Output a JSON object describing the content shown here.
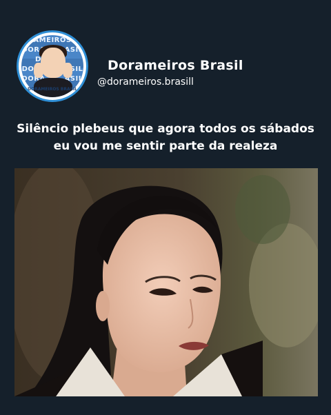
{
  "profile": {
    "name": "Dorameiros Brasil",
    "handle": "@dorameiros.brasill",
    "avatar_text": "DORAMEIROS BRASIL"
  },
  "post": {
    "caption_line1": "Silêncio plebeus que agora todos os sábados",
    "caption_line2": "eu vou me sentir parte da realeza"
  },
  "colors": {
    "background": "#15202b",
    "text": "#ffffff",
    "avatar_ring": "#2f8fd6"
  }
}
